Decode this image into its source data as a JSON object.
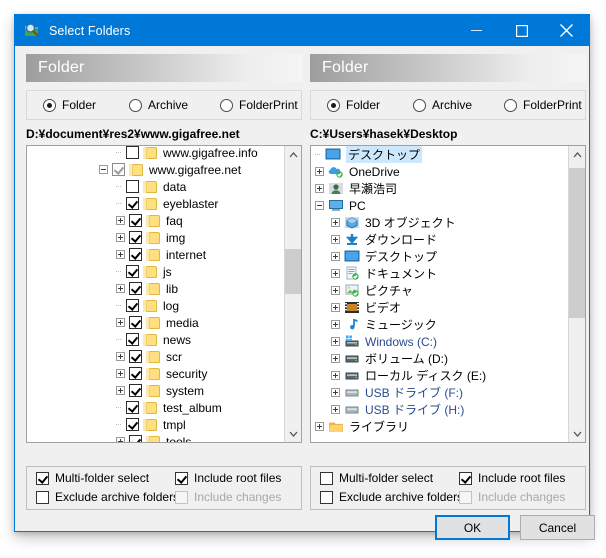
{
  "window": {
    "title": "Select Folders",
    "icon": "magnifier-folder-icon",
    "accent": "#0078d7",
    "controls": {
      "minimize": "minimize-icon",
      "maximize": "maximize-icon",
      "close": "close-icon"
    }
  },
  "panels": [
    {
      "id": "left",
      "header": "Folder",
      "modes": [
        {
          "label": "Folder",
          "selected": true
        },
        {
          "label": "Archive",
          "selected": false
        },
        {
          "label": "FolderPrint",
          "selected": false
        }
      ],
      "path": "D:¥document¥res2¥www.gigafree.net",
      "scroll": {
        "thumb_top_pct": 33,
        "thumb_height_pct": 17
      },
      "tree": [
        {
          "indent": 5,
          "expander": "none",
          "check": "off",
          "label": "www.gigafree.info"
        },
        {
          "indent": 4,
          "expander": "minus",
          "check": "partial",
          "label": "www.gigafree.net"
        },
        {
          "indent": 5,
          "expander": "none",
          "check": "off",
          "label": "data"
        },
        {
          "indent": 5,
          "expander": "none",
          "check": "on",
          "label": "eyeblaster"
        },
        {
          "indent": 5,
          "expander": "plus",
          "check": "on",
          "label": "faq"
        },
        {
          "indent": 5,
          "expander": "plus",
          "check": "on",
          "label": "img"
        },
        {
          "indent": 5,
          "expander": "plus",
          "check": "on",
          "label": "internet"
        },
        {
          "indent": 5,
          "expander": "none",
          "check": "on",
          "label": "js"
        },
        {
          "indent": 5,
          "expander": "plus",
          "check": "on",
          "label": "lib"
        },
        {
          "indent": 5,
          "expander": "none",
          "check": "on",
          "label": "log"
        },
        {
          "indent": 5,
          "expander": "plus",
          "check": "on",
          "label": "media"
        },
        {
          "indent": 5,
          "expander": "none",
          "check": "on",
          "label": "news"
        },
        {
          "indent": 5,
          "expander": "plus",
          "check": "on",
          "label": "scr"
        },
        {
          "indent": 5,
          "expander": "plus",
          "check": "on",
          "label": "security"
        },
        {
          "indent": 5,
          "expander": "plus",
          "check": "on",
          "label": "system"
        },
        {
          "indent": 5,
          "expander": "none",
          "check": "on",
          "label": "test_album"
        },
        {
          "indent": 5,
          "expander": "none",
          "check": "on",
          "label": "tmpl"
        },
        {
          "indent": 5,
          "expander": "plus",
          "check": "on",
          "label": "tools"
        }
      ],
      "options": [
        {
          "label": "Multi-folder select",
          "checked": true,
          "disabled": false
        },
        {
          "label": "Include root files",
          "checked": true,
          "disabled": false
        },
        {
          "label": "Exclude archive folders",
          "checked": false,
          "disabled": false
        },
        {
          "label": "Include changes",
          "checked": false,
          "disabled": true
        }
      ]
    },
    {
      "id": "right",
      "header": "Folder",
      "modes": [
        {
          "label": "Folder",
          "selected": true
        },
        {
          "label": "Archive",
          "selected": false
        },
        {
          "label": "FolderPrint",
          "selected": false
        }
      ],
      "path": "C:¥Users¥hasek¥Desktop",
      "scroll": {
        "thumb_top_pct": 2,
        "thumb_height_pct": 57
      },
      "tree": [
        {
          "indent": 0,
          "expander": "none",
          "icon": "desktop-icon",
          "label": "デスクトップ",
          "selected": true
        },
        {
          "indent": 0,
          "expander": "plus",
          "icon": "onedrive-icon",
          "label": "OneDrive"
        },
        {
          "indent": 0,
          "expander": "plus",
          "icon": "user-icon",
          "label": "早瀬浩司"
        },
        {
          "indent": 0,
          "expander": "minus",
          "icon": "pc-icon",
          "label": "PC"
        },
        {
          "indent": 1,
          "expander": "plus",
          "icon": "3dobjects-icon",
          "label": "3D オブジェクト"
        },
        {
          "indent": 1,
          "expander": "plus",
          "icon": "downloads-icon",
          "label": "ダウンロード"
        },
        {
          "indent": 1,
          "expander": "plus",
          "icon": "desktop-icon",
          "label": "デスクトップ"
        },
        {
          "indent": 1,
          "expander": "plus",
          "icon": "documents-icon",
          "label": "ドキュメント"
        },
        {
          "indent": 1,
          "expander": "plus",
          "icon": "pictures-icon",
          "label": "ピクチャ"
        },
        {
          "indent": 1,
          "expander": "plus",
          "icon": "videos-icon",
          "label": "ビデオ"
        },
        {
          "indent": 1,
          "expander": "plus",
          "icon": "music-icon",
          "label": "ミュージック"
        },
        {
          "indent": 1,
          "expander": "plus",
          "icon": "windows-drive-icon",
          "label": "Windows (C:)",
          "blue": true
        },
        {
          "indent": 1,
          "expander": "plus",
          "icon": "drive-icon",
          "label": "ボリューム (D:)"
        },
        {
          "indent": 1,
          "expander": "plus",
          "icon": "drive-icon",
          "label": "ローカル ディスク (E:)"
        },
        {
          "indent": 1,
          "expander": "plus",
          "icon": "usb-drive-icon",
          "label": "USB ドライブ (F:)",
          "blue": true
        },
        {
          "indent": 1,
          "expander": "plus",
          "icon": "usb-drive-icon",
          "label": "USB ドライブ (H:)",
          "blue": true
        },
        {
          "indent": 0,
          "expander": "plus",
          "icon": "library-icon",
          "label": "ライブラリ"
        }
      ],
      "options": [
        {
          "label": "Multi-folder select",
          "checked": false,
          "disabled": false
        },
        {
          "label": "Include root files",
          "checked": true,
          "disabled": false
        },
        {
          "label": "Exclude archive folders",
          "checked": false,
          "disabled": false
        },
        {
          "label": "Include changes",
          "checked": false,
          "disabled": true
        }
      ]
    }
  ],
  "buttons": {
    "ok": "OK",
    "cancel": "Cancel"
  }
}
